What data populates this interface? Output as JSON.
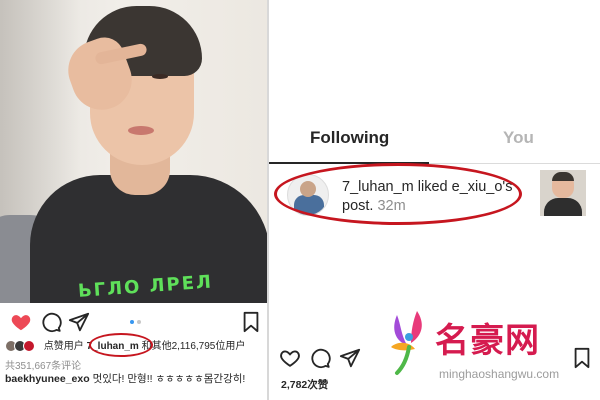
{
  "left_post": {
    "shirt_print": "ЬГЛО ЛРЕЛ",
    "likes_text_prefix": "点赞用户",
    "liker_highlight": "7_luhan_m",
    "likes_text_suffix": "和其他2,116,795位用户",
    "comments_count": "共351,667条评论",
    "comment_user": "baekhyunee_exo",
    "comment_text": "멋있다! 만형!! ㅎㅎㅎㅎㅎ몸간강히!"
  },
  "right_panel": {
    "tabs": [
      {
        "label": "Following"
      },
      {
        "label": "You"
      }
    ],
    "notification": {
      "actor": "7_luhan_m",
      "action": "liked",
      "target": "e_xiu_o's post.",
      "time": "32m"
    },
    "likes_count": "2,782次赞"
  },
  "watermark": {
    "title": "名豪网",
    "url": "minghaoshangwu.com"
  },
  "colors": {
    "highlight_red": "#c6161f",
    "like_red": "#ed4956",
    "carousel_blue": "#3897f0",
    "watermark_pink": "#d51b4f"
  },
  "icons": [
    "heart-icon",
    "comment-icon",
    "share-icon",
    "bookmark-icon"
  ]
}
